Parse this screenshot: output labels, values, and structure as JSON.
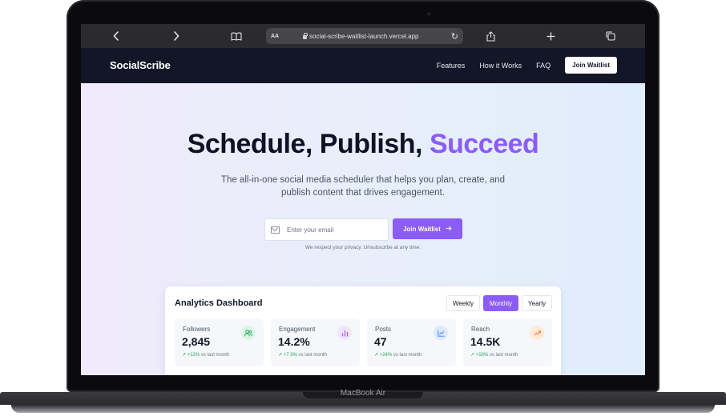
{
  "device": {
    "model_label": "MacBook Air"
  },
  "browser": {
    "back_icon": "chevron-left-icon",
    "forward_icon": "chevron-right-icon",
    "reader_label": "AA",
    "url": "social-scribe-waitlist-launch.vercel.app"
  },
  "nav": {
    "logo": "SocialScribe",
    "links": [
      "Features",
      "How it Works",
      "FAQ"
    ],
    "cta": "Join Waitlist"
  },
  "hero": {
    "headline_part1": "Schedule, Publish, ",
    "headline_accent": "Succeed",
    "subtitle_line1": "The all-in-one social media scheduler that helps you plan, create, and",
    "subtitle_line2": "publish content that drives engagement.",
    "email_placeholder": "Enter your email",
    "cta": "Join Waitlist",
    "privacy": "We respect your privacy. Unsubscribe at any time."
  },
  "dashboard": {
    "title": "Analytics Dashboard",
    "periods": [
      "Weekly",
      "Monthly",
      "Yearly"
    ],
    "active_period": "Monthly",
    "cards": [
      {
        "label": "Followers",
        "value": "2,845",
        "change": "+12%",
        "suffix": "vs last month",
        "icon": "users-icon",
        "icon_color": "#22a55b",
        "icon_bg": "#dcf5e4"
      },
      {
        "label": "Engagement",
        "value": "14.2%",
        "change": "+7.3%",
        "suffix": "vs last month",
        "icon": "bar-chart-icon",
        "icon_color": "#a855f7",
        "icon_bg": "#f1e6fd"
      },
      {
        "label": "Posts",
        "value": "47",
        "change": "+24%",
        "suffix": "vs last month",
        "icon": "line-chart-icon",
        "icon_color": "#3b82f6",
        "icon_bg": "#dde9fd"
      },
      {
        "label": "Reach",
        "value": "14.5K",
        "change": "+18%",
        "suffix": "vs last month",
        "icon": "trending-up-icon",
        "icon_color": "#f97316",
        "icon_bg": "#fdebd9"
      }
    ]
  },
  "colors": {
    "accent": "#8b5cf6",
    "nav_bg": "#121627",
    "positive": "#22a55b"
  }
}
